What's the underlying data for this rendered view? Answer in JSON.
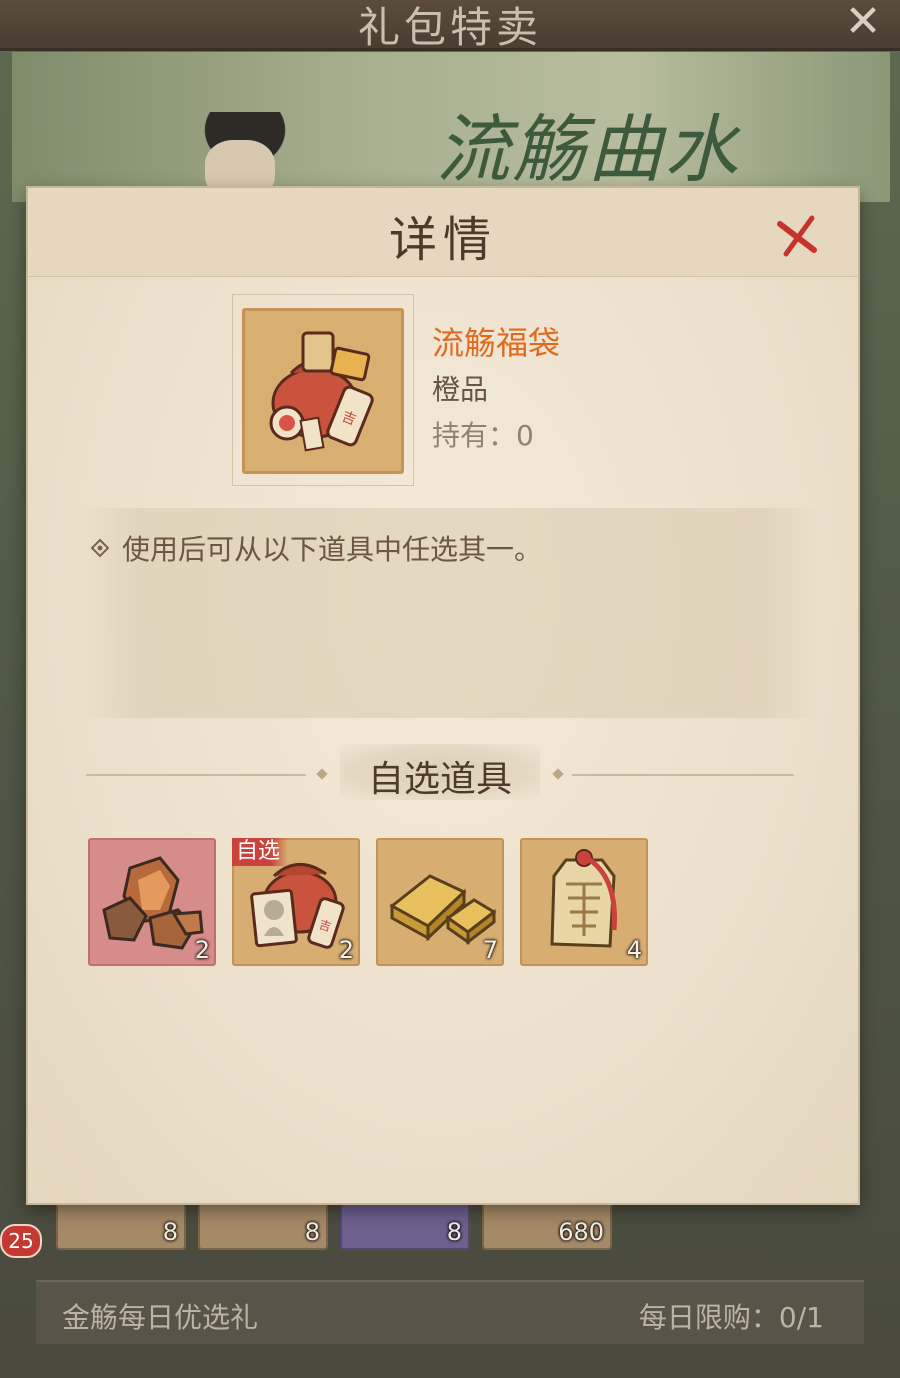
{
  "background": {
    "header_title": "礼包特卖",
    "banner_title": "流觞曲水",
    "strip_counts": [
      "8",
      "8",
      "8",
      "680"
    ],
    "badge_count": "25",
    "bottom_item_name": "金觞每日优选礼",
    "bottom_limit": "每日限购：0/1"
  },
  "dialog": {
    "title": "详情",
    "item": {
      "name": "流觞福袋",
      "grade": "橙品",
      "owned": "持有：0",
      "icon": "lucky-bag-icon"
    },
    "description": "使用后可从以下道具中任选其一。",
    "section_title": "自选道具",
    "choices": [
      {
        "icon": "ore-stones-icon",
        "count": "2",
        "tag": ""
      },
      {
        "icon": "gift-bag-icon",
        "count": "2",
        "tag": "自选"
      },
      {
        "icon": "gold-bars-icon",
        "count": "7",
        "tag": ""
      },
      {
        "icon": "jade-token-icon",
        "count": "4",
        "tag": ""
      }
    ]
  },
  "colors": {
    "item_name": "#e06b1f",
    "dialog_bg": "#ede2cf",
    "close_x": "#c8322d"
  }
}
